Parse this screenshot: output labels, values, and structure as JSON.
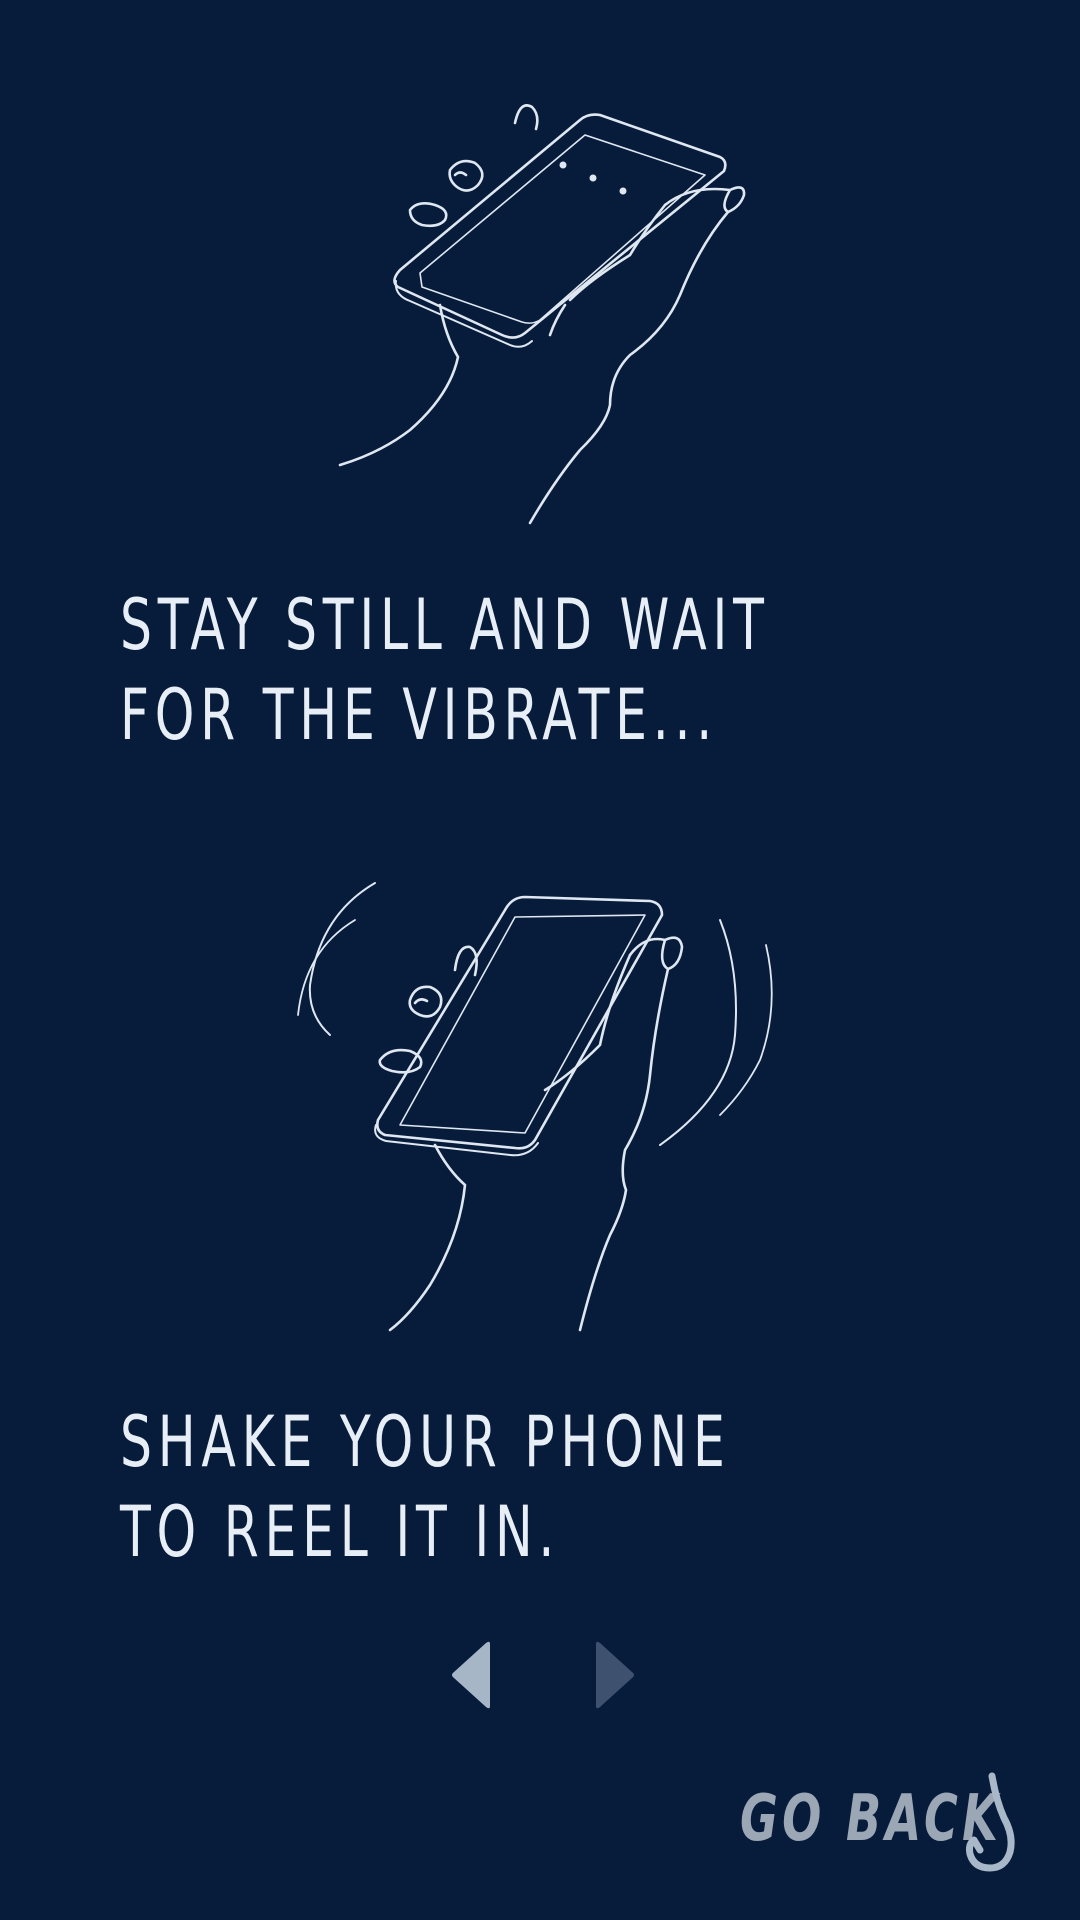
{
  "instructions": [
    {
      "line1": "STAY STILL AND WAIT",
      "line2": "FOR THE VIBRATE..."
    },
    {
      "line1": "SHAKE YOUR PHONE",
      "line2": "TO REEL IT IN."
    }
  ],
  "navigation": {
    "prev_icon": "triangle-left",
    "next_icon": "triangle-right"
  },
  "go_back": {
    "label": "GO BACK",
    "icon": "fishing-hook"
  },
  "colors": {
    "background": "#071c3b",
    "text": "#e8eef6",
    "line_art": "#dfe7f1",
    "prev_arrow": "#a7b6c7",
    "next_arrow": "#3e5270",
    "go_back": "#9ba7b5"
  }
}
